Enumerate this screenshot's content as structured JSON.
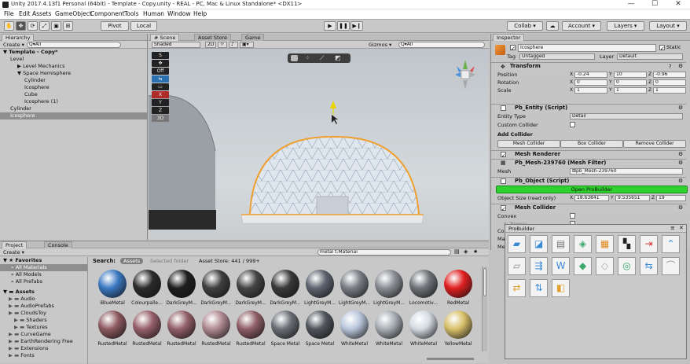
{
  "window": {
    "title": "Unity 2017.4.13f1 Personal (64bit) - Template - Copy.unity - REAL - PC, Mac & Linux Standalone* <DX11>",
    "min": "—",
    "max": "☐",
    "close": "✕"
  },
  "menu": [
    "File",
    "Edit",
    "Assets",
    "GameObject",
    "Component",
    "Tools",
    "Human",
    "Window",
    "Help"
  ],
  "toolbar": {
    "pivot": "Pivot",
    "local": "Local",
    "collab": "Collab ▾",
    "account": "Account ▾",
    "layers": "Layers ▾",
    "layout": "Layout ▾"
  },
  "hierarchy": {
    "tab": "Hierarchy",
    "create": "Create ▾",
    "search": "Q▾All",
    "items": [
      {
        "label": "▼ Template - Copy*",
        "indent": 0,
        "bold": true,
        "sel": false
      },
      {
        "label": "Level",
        "indent": 1,
        "bold": false,
        "sel": false
      },
      {
        "label": "▶ Level Mechanics",
        "indent": 2,
        "bold": false,
        "sel": false
      },
      {
        "label": "▼ Space Hemisphere",
        "indent": 2,
        "bold": false,
        "sel": false
      },
      {
        "label": "Cylinder",
        "indent": 3,
        "bold": false,
        "sel": false
      },
      {
        "label": "Icosphere",
        "indent": 3,
        "bold": false,
        "sel": false
      },
      {
        "label": "Cube",
        "indent": 3,
        "bold": false,
        "sel": false
      },
      {
        "label": "Icosphere (1)",
        "indent": 3,
        "bold": false,
        "sel": false
      },
      {
        "label": "Cylinder",
        "indent": 1,
        "bold": false,
        "sel": false
      },
      {
        "label": "Icosphere",
        "indent": 1,
        "bold": false,
        "sel": true
      }
    ]
  },
  "scene": {
    "tabs": [
      "# Scene",
      "Asset Store",
      "Game"
    ],
    "shading": "Shaded",
    "mode2d": "2D",
    "gizmos": "Gizmos ▾",
    "search": "Q▾All",
    "tools": [
      "S",
      "✥",
      "Off",
      "⇆",
      "▭",
      "X",
      "Y",
      "Z",
      "3D"
    ]
  },
  "inspector": {
    "tab": "Inspector",
    "name": "Icosphere",
    "static": "Static",
    "tag_label": "Tag",
    "tag": "Untagged",
    "layer_label": "Layer",
    "layer": "Default",
    "transform": {
      "title": "Transform",
      "rows": [
        {
          "label": "Position",
          "x": "-0.24",
          "y": "10",
          "z": "-0.96"
        },
        {
          "label": "Rotation",
          "x": "0",
          "y": "0",
          "z": "0"
        },
        {
          "label": "Scale",
          "x": "1",
          "y": "1",
          "z": "1"
        }
      ]
    },
    "pb_entity": {
      "title": "Pb_Entity (Script)",
      "entity_type_label": "Entity Type",
      "entity_type": "Detail",
      "custom_collider": "Custom Collider",
      "add_collider": "Add Collider",
      "buttons": [
        "Mesh Collider",
        "Box Collider",
        "Remove Collider"
      ]
    },
    "mesh_renderer": "Mesh Renderer",
    "mesh_filter": {
      "title": "Pb_Mesh-239760 (Mesh Filter)",
      "mesh_label": "Mesh",
      "mesh": "⊞pb_Mesh-239760"
    },
    "pb_object": {
      "title": "Pb_Object (Script)",
      "open": "Open ProBuilder",
      "size_label": "Object Size (read only)",
      "x": "18.63841",
      "y": "9.535651",
      "z": "19"
    },
    "mesh_collider": {
      "title": "Mesh Collider",
      "convex": "Convex",
      "is_trigger": "Is Trigger",
      "c": "Co",
      "ma": "Ma",
      "me": "Me"
    }
  },
  "project": {
    "tabs": [
      "Project",
      "Console"
    ],
    "create": "Create ▾",
    "favorites_title": "Favorites",
    "favorites": [
      "All Materials",
      "All Models",
      "All Prefabs"
    ],
    "assets_title": "Assets",
    "assets": [
      "Audio",
      "AudioPrefabs",
      "CloudsToy",
      "Shaders",
      "Textures",
      "CurveGame",
      "EarthRendering Free",
      "Extensions",
      "Fonts"
    ],
    "search": "metal t:Material",
    "search_label": "Search:",
    "scope_assets": "Assets",
    "scope_selected": "Selected folder",
    "asset_store": "Asset Store: 441 / 999+",
    "row1": [
      {
        "n": "iBlueMetal",
        "c": "#3b78c2"
      },
      {
        "n": "Colourpalle...",
        "c": "#2b2b2b"
      },
      {
        "n": "DarkGreyM...",
        "c": "#1e1e1e"
      },
      {
        "n": "DarkGreyM...",
        "c": "#3f3f3f"
      },
      {
        "n": "DarkGreyM...",
        "c": "#454545"
      },
      {
        "n": "DarkGreyM...",
        "c": "#393939"
      },
      {
        "n": "LightGreyM...",
        "c": "#5e6470"
      },
      {
        "n": "LightGreyM...",
        "c": "#7a7f85"
      },
      {
        "n": "LightGreyM...",
        "c": "#8a8e94"
      },
      {
        "n": "Locomotiv...",
        "c": "#6e7378"
      },
      {
        "n": "RedMetal",
        "c": "#e02020"
      }
    ],
    "row2": [
      {
        "n": "RustedMetal",
        "c": "#8d5a5f"
      },
      {
        "n": "RustedMetal",
        "c": "#97606a"
      },
      {
        "n": "RustedMetal",
        "c": "#936068"
      },
      {
        "n": "RustedMetal",
        "c": "#b08a92"
      },
      {
        "n": "RustedMetal",
        "c": "#8f5f66"
      },
      {
        "n": "Space Metal",
        "c": "#6a6f75"
      },
      {
        "n": "Space Metal",
        "c": "#50555c"
      },
      {
        "n": "WhiteMetal",
        "c": "#b9c7dc"
      },
      {
        "n": "WhiteMetal",
        "c": "#a8aeb5"
      },
      {
        "n": "WhiteMetal",
        "c": "#d4dbe2"
      },
      {
        "n": "YellowMetal",
        "c": "#d8c06a"
      }
    ]
  },
  "probuilder": {
    "title": "ProBuilder",
    "close": "✕"
  }
}
